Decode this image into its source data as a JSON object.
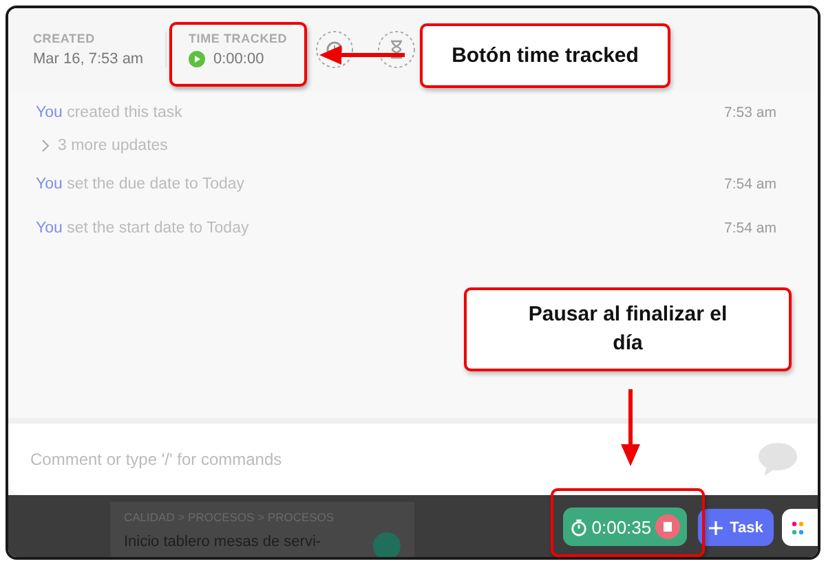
{
  "header": {
    "created": {
      "label": "CREATED",
      "value": "Mar 16, 7:53 am"
    },
    "time_tracked": {
      "label": "TIME TRACKED",
      "value": "0:00:00"
    }
  },
  "activity": [
    {
      "kind": "event",
      "actor": "You",
      "text": "created this task",
      "time": "7:53 am"
    },
    {
      "kind": "more",
      "text": "3 more updates"
    },
    {
      "kind": "event",
      "actor": "You",
      "text": "set the due date to Today",
      "time": "7:54 am"
    },
    {
      "kind": "event",
      "actor": "You",
      "text": "set the start date to Today",
      "time": "7:54 am"
    }
  ],
  "comment": {
    "placeholder": "Comment or type '/' for commands"
  },
  "bottom_bar": {
    "card": {
      "breadcrumb": "CALIDAD > PROCESOS > PROCESOS",
      "title": "Inicio tablero mesas de servi-"
    },
    "timer": {
      "value": "0:00:35"
    },
    "task_button": {
      "label": "Task"
    }
  },
  "annotations": [
    {
      "text": "Botón time tracked"
    },
    {
      "text": "Pausar al finalizar el día"
    }
  ]
}
